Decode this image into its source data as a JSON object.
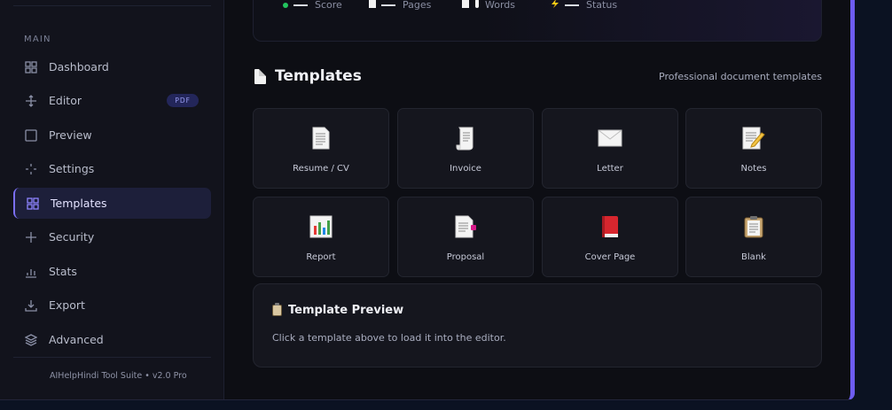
{
  "sidebar": {
    "section_label": "MAIN",
    "items": [
      {
        "label": "Dashboard",
        "icon": "grid-icon"
      },
      {
        "label": "Editor",
        "icon": "move-icon",
        "badge": "PDF"
      },
      {
        "label": "Preview",
        "icon": "square-icon"
      },
      {
        "label": "Settings",
        "icon": "crosshair-icon"
      },
      {
        "label": "Templates",
        "icon": "grid-icon",
        "active": true
      },
      {
        "label": "Security",
        "icon": "plus-icon"
      },
      {
        "label": "Stats",
        "icon": "bar-chart-icon"
      },
      {
        "label": "Export",
        "icon": "download-icon"
      },
      {
        "label": "Advanced",
        "icon": "layers-icon"
      }
    ],
    "footer": "AIHelpHindi Tool Suite • v2.0 Pro"
  },
  "stats": [
    {
      "label": "Score",
      "marker_color": "#22c55e"
    },
    {
      "label": "Pages",
      "marker_color": "#f2f2f2"
    },
    {
      "label": "Words",
      "marker_color": "#f2f2f2"
    },
    {
      "label": "Status",
      "marker_color": "#facc15"
    }
  ],
  "templates_section": {
    "title": "Templates",
    "subtitle": "Professional document templates",
    "items": [
      {
        "label": "Resume / CV",
        "icon": "page-icon"
      },
      {
        "label": "Invoice",
        "icon": "receipt-icon"
      },
      {
        "label": "Letter",
        "icon": "envelope-icon"
      },
      {
        "label": "Notes",
        "icon": "memo-icon"
      },
      {
        "label": "Report",
        "icon": "bar-chart-icon"
      },
      {
        "label": "Proposal",
        "icon": "document-pen-icon"
      },
      {
        "label": "Cover Page",
        "icon": "book-icon"
      },
      {
        "label": "Blank",
        "icon": "clipboard-icon"
      }
    ]
  },
  "preview": {
    "title": "Template Preview",
    "text": "Click a template above to load it into the editor."
  },
  "colors": {
    "accent": "#6d5cf0",
    "background": "#0d0e14",
    "sidebar": "#12131c"
  }
}
